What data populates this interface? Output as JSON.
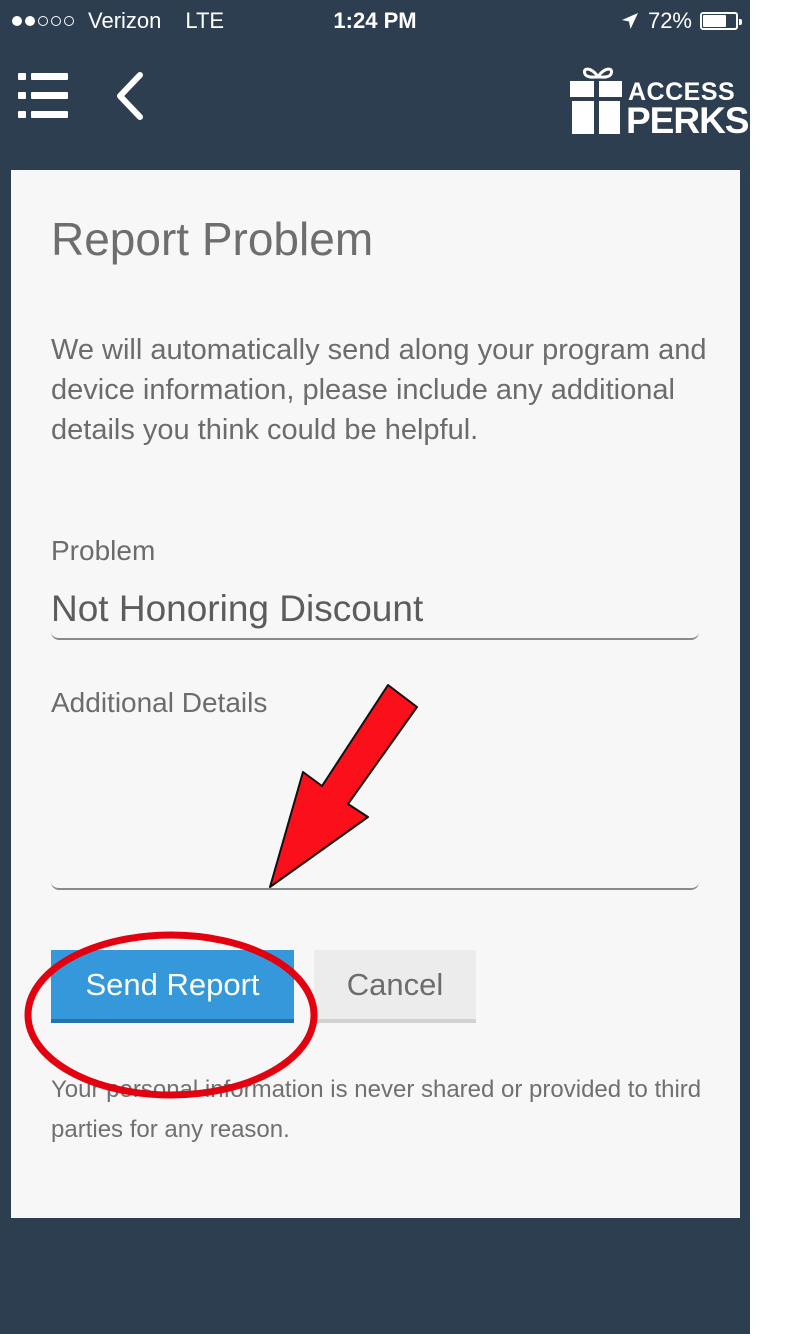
{
  "status_bar": {
    "carrier": "Verizon",
    "network": "LTE",
    "time": "1:24 PM",
    "battery": "72%",
    "battery_level": 0.72,
    "signal_bars_filled": 2,
    "signal_bars_total": 5
  },
  "header": {
    "logo_line1": "ACCESS",
    "logo_line2": "PERKS"
  },
  "form": {
    "title": "Report Problem",
    "intro": "We will automatically send along your program and device information, please include any additional details you think could be helpful.",
    "problem_label": "Problem",
    "problem_value": "Not Honoring Discount",
    "details_label": "Additional Details",
    "details_value": "",
    "send_label": "Send Report",
    "cancel_label": "Cancel",
    "privacy_note": "Your personal information is never shared or provided to third parties for any reason."
  },
  "colors": {
    "header_bg": "#2d3e50",
    "card_bg": "#f7f7f7",
    "send_button": "#3498db",
    "cancel_button": "#ececec",
    "annotation": "#e3000f"
  },
  "icons": [
    "menu-icon",
    "back-icon",
    "location-arrow-icon",
    "battery-icon",
    "gift-icon"
  ]
}
